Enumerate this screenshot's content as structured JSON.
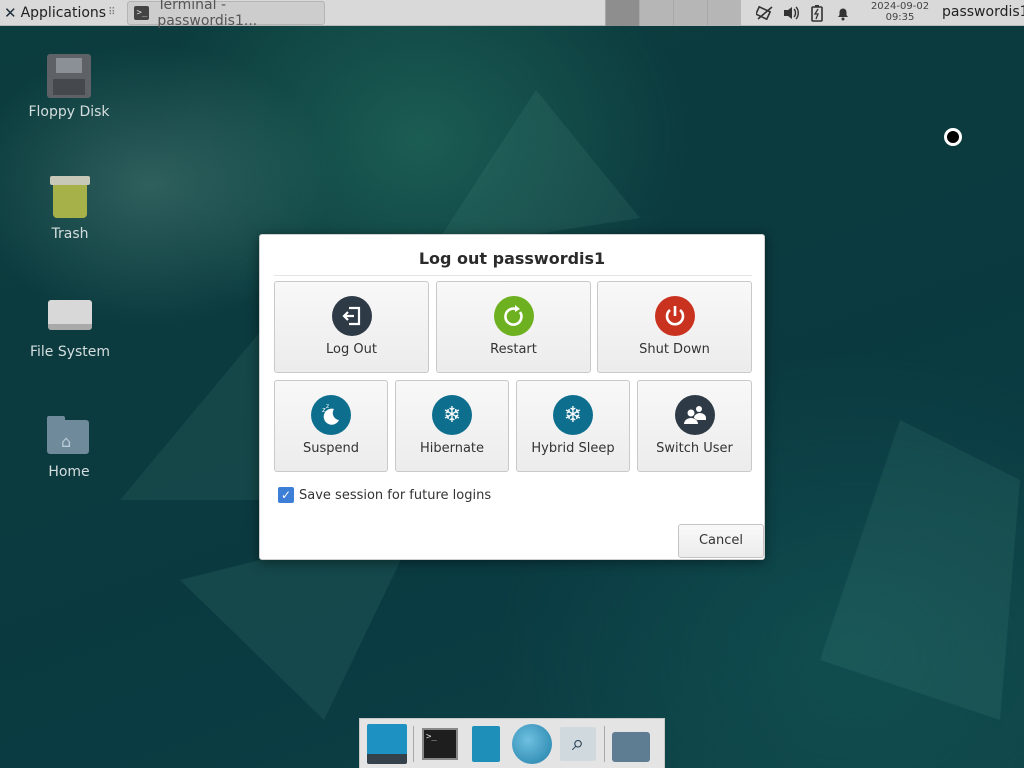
{
  "panel": {
    "applications_label": "Applications",
    "task_label": "Terminal - passwordis1...",
    "clock_date": "2024-09-02",
    "clock_time": "09:35",
    "username": "passwordis1",
    "tray_icons": [
      "network-icon",
      "volume-icon",
      "battery-icon",
      "notification-bell-icon"
    ]
  },
  "desktop": {
    "icons": [
      {
        "label": "Floppy Disk"
      },
      {
        "label": "Trash"
      },
      {
        "label": "File System"
      },
      {
        "label": "Home"
      }
    ]
  },
  "dialog": {
    "title": "Log out passwordis1",
    "actions": [
      {
        "label": "Log Out",
        "icon": "logout-icon",
        "color": "#2e3a45"
      },
      {
        "label": "Restart",
        "icon": "restart-icon",
        "color": "#6db120"
      },
      {
        "label": "Shut Down",
        "icon": "power-icon",
        "color": "#c9321f"
      },
      {
        "label": "Suspend",
        "icon": "moon-icon",
        "color": "#0e6e8e"
      },
      {
        "label": "Hibernate",
        "icon": "snowflake-icon",
        "color": "#0e6e8e"
      },
      {
        "label": "Hybrid Sleep",
        "icon": "snowflake-icon",
        "color": "#0e6e8e"
      },
      {
        "label": "Switch User",
        "icon": "switch-user-icon",
        "color": "#2e3a45"
      }
    ],
    "save_session_label": "Save session for future logins",
    "save_session_checked": true,
    "cancel_label": "Cancel"
  },
  "dock": {
    "items": [
      "show-desktop-icon",
      "terminal-icon",
      "file-manager-icon",
      "web-browser-icon",
      "app-finder-icon",
      "folder-icon"
    ]
  }
}
